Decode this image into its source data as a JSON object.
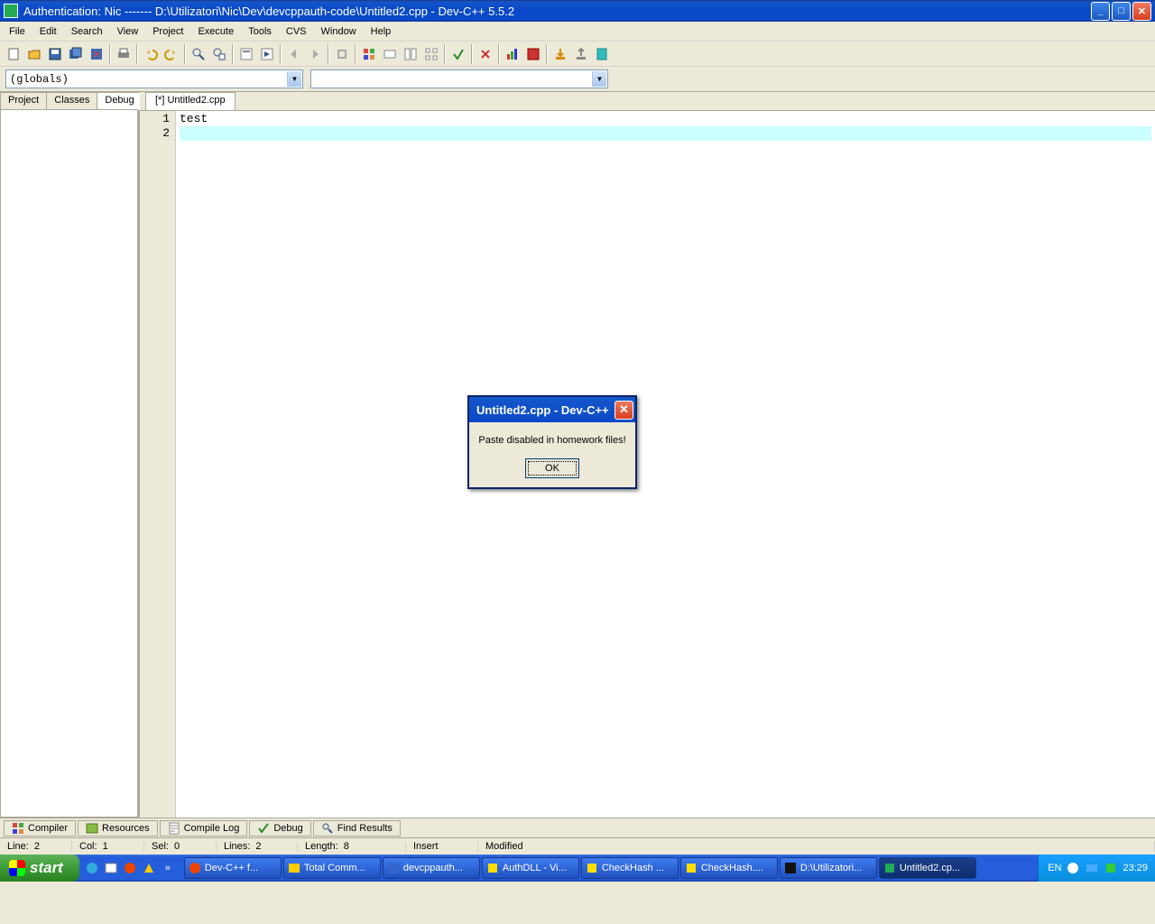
{
  "titlebar": {
    "text": "Authentication: Nic ------- D:\\Utilizatori\\Nic\\Dev\\devcppauth-code\\Untitled2.cpp - Dev-C++ 5.5.2"
  },
  "menu": {
    "items": [
      "File",
      "Edit",
      "Search",
      "View",
      "Project",
      "Execute",
      "Tools",
      "CVS",
      "Window",
      "Help"
    ]
  },
  "combo": {
    "globals": "(globals)",
    "second": ""
  },
  "left_tabs": [
    "Project",
    "Classes",
    "Debug"
  ],
  "file_tabs": [
    "[*] Untitled2.cpp"
  ],
  "editor": {
    "lines": [
      "test",
      ""
    ],
    "line_numbers": [
      "1",
      "2"
    ]
  },
  "bottom_tabs": [
    "Compiler",
    "Resources",
    "Compile Log",
    "Debug",
    "Find Results"
  ],
  "status": {
    "line_lbl": "Line:",
    "line_val": "2",
    "col_lbl": "Col:",
    "col_val": "1",
    "sel_lbl": "Sel:",
    "sel_val": "0",
    "lines_lbl": "Lines:",
    "lines_val": "2",
    "length_lbl": "Length:",
    "length_val": "8",
    "insert": "Insert",
    "modified": "Modified"
  },
  "dialog": {
    "title": "Untitled2.cpp - Dev-C++",
    "message": "Paste disabled in homework files!",
    "ok": "OK"
  },
  "taskbar": {
    "start": "start",
    "items": [
      "Dev-C++ f...",
      "Total Comm...",
      "devcppauth...",
      "AuthDLL - Vi...",
      "CheckHash ...",
      "CheckHash....",
      "D:\\Utilizatori...",
      "Untitled2.cp..."
    ],
    "lang": "EN",
    "clock": "23:29"
  }
}
